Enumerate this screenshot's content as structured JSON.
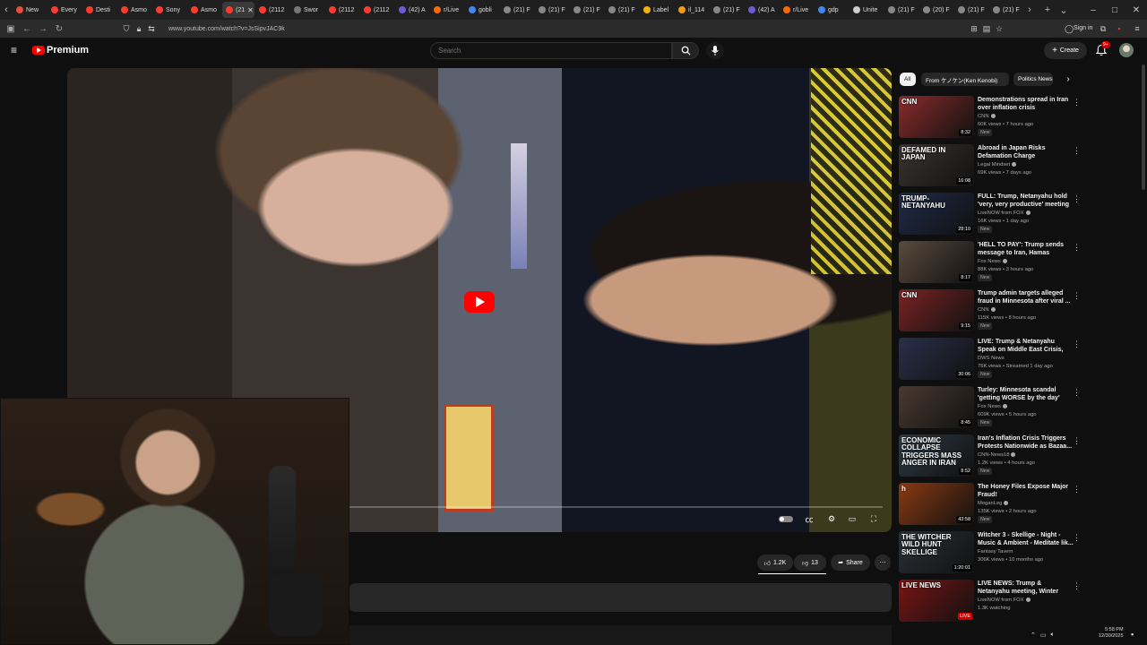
{
  "browser": {
    "tabs": [
      {
        "label": "New",
        "color": "#e74c3c"
      },
      {
        "label": "Every",
        "color": "#ff3b30"
      },
      {
        "label": "Desti",
        "color": "#ff3b30"
      },
      {
        "label": "Asmo",
        "color": "#ff3b30"
      },
      {
        "label": "Sony",
        "color": "#ff3b30"
      },
      {
        "label": "Asmo",
        "color": "#ff3b30"
      },
      {
        "label": "(21",
        "color": "#ff3b30",
        "active": true
      },
      {
        "label": "(2112",
        "color": "#ff3b30"
      },
      {
        "label": "Swor",
        "color": "#777777"
      },
      {
        "label": "(2112",
        "color": "#ff3b30"
      },
      {
        "label": "(2112",
        "color": "#ff3b30"
      },
      {
        "label": "(42) A",
        "color": "#6b5bd6"
      },
      {
        "label": "r/Live",
        "color": "#ff6a00"
      },
      {
        "label": "gobli",
        "color": "#4285f4"
      },
      {
        "label": "(21) F",
        "color": "#888888"
      },
      {
        "label": "(21) F",
        "color": "#888888"
      },
      {
        "label": "(21) F",
        "color": "#888888"
      },
      {
        "label": "(21) F",
        "color": "#888888"
      },
      {
        "label": "Label",
        "color": "#f4b400"
      },
      {
        "label": "il_114",
        "color": "#f39c12"
      },
      {
        "label": "(21) F",
        "color": "#888888"
      },
      {
        "label": "(42) A",
        "color": "#6b5bd6"
      },
      {
        "label": "r/Live",
        "color": "#ff6a00"
      },
      {
        "label": "gdp",
        "color": "#4285f4"
      },
      {
        "label": "Unite",
        "color": "#cccccc"
      },
      {
        "label": "(21) F",
        "color": "#888888"
      },
      {
        "label": "(20) F",
        "color": "#888888"
      },
      {
        "label": "(21) F",
        "color": "#888888"
      },
      {
        "label": "(21) F",
        "color": "#888888"
      }
    ],
    "url": "www.youtube.com/watch?v=JsSipvJAC9k",
    "sign_in": "Sign in"
  },
  "header": {
    "logo_text": "Premium",
    "search_placeholder": "Search",
    "create_label": "Create",
    "notif_count": "9+"
  },
  "player": {
    "controls": [
      "autoplay",
      "subtitles",
      "settings",
      "miniplayer",
      "fullscreen"
    ]
  },
  "actions": {
    "likes": "1.2K",
    "dislikes": "13",
    "share": "Share"
  },
  "chips": [
    {
      "label": "All",
      "active": true
    },
    {
      "label": "From ケノケン(Ken Kenobi)",
      "active": false
    },
    {
      "label": "Politics News",
      "active": false
    }
  ],
  "recommendations": [
    {
      "title": "Demonstrations spread in Iran over inflation crisis",
      "channel": "CNN",
      "verified": true,
      "meta": "60K views • 7 hours ago",
      "new": "New",
      "duration": "8:32",
      "thumb_text": "CNN",
      "thumb_bg": "#8a2b2b"
    },
    {
      "title": "Abroad in Japan Risks Defamation Charge",
      "channel": "Legal Mindset",
      "verified": true,
      "meta": "69K views • 7 days ago",
      "new": "",
      "duration": "16:08",
      "thumb_text": "DEFAMED IN JAPAN",
      "thumb_bg": "#3a3431"
    },
    {
      "title": "FULL: Trump, Netanyahu hold 'very, very productive' meeting ...",
      "channel": "LiveNOW from FOX",
      "verified": true,
      "meta": "16K views • 1 day ago",
      "new": "New",
      "duration": "28:10",
      "thumb_text": "TRUMP-NETANYAHU",
      "thumb_bg": "#1e2a48"
    },
    {
      "title": "'HELL TO PAY': Trump sends message to Iran, Hamas",
      "channel": "Fox News",
      "verified": true,
      "meta": "88K views • 3 hours ago",
      "new": "New",
      "duration": "8:17",
      "thumb_text": "",
      "thumb_bg": "#5a4a3d"
    },
    {
      "title": "Trump admin targets alleged fraud in Minnesota after viral ...",
      "channel": "CNN",
      "verified": true,
      "meta": "115K views • 8 hours ago",
      "new": "New",
      "duration": "9:15",
      "thumb_text": "CNN",
      "thumb_bg": "#7a2222"
    },
    {
      "title": "LIVE: Trump & Netanyahu Speak on Middle East Crisis, Hamas, ...",
      "channel": "DWS News",
      "verified": false,
      "meta": "76K views • Streamed 1 day ago",
      "new": "New",
      "duration": "30:06",
      "thumb_text": "",
      "thumb_bg": "#2a2f4a"
    },
    {
      "title": "Turley: Minnesota scandal 'getting WORSE by the day'",
      "channel": "Fox News",
      "verified": true,
      "meta": "609K views • 5 hours ago",
      "new": "New",
      "duration": "8:45",
      "thumb_text": "",
      "thumb_bg": "#4a3a30"
    },
    {
      "title": "Iran's Inflation Crisis Triggers Protests Nationwide as Bazaa...",
      "channel": "CNN-News18",
      "verified": true,
      "meta": "1.2K views • 4 hours ago",
      "new": "New",
      "duration": "8:52",
      "thumb_text": "ECONOMIC COLLAPSE TRIGGERS MASS ANGER IN IRAN",
      "thumb_bg": "#2d3a45"
    },
    {
      "title": "The Honey Files Expose Major Fraud!",
      "channel": "MeganLeg",
      "verified": true,
      "meta": "135K views • 2 hours ago",
      "new": "New",
      "duration": "43:58",
      "thumb_text": "h",
      "thumb_bg": "#8a3a12"
    },
    {
      "title": "Witcher 3 - Skellige - Night - Music & Ambient - Meditate lik...",
      "channel": "Fantasy Tavern",
      "verified": false,
      "meta": "306K views • 10 months ago",
      "new": "",
      "duration": "1:20:01",
      "thumb_text": "THE WITCHER WILD HUNT SKELLIGE",
      "thumb_bg": "#2b3136"
    },
    {
      "title": "LIVE NEWS: Trump & Netanyahu meeting, Winter weather, NYE ...",
      "channel": "LiveNOW from FOX",
      "verified": true,
      "meta": "1.3K watching",
      "new": "",
      "duration": "LIVE",
      "thumb_text": "LIVE NEWS",
      "thumb_bg": "#7a1414"
    }
  ],
  "tray": {
    "time": "5:58 PM",
    "date": "12/30/2025"
  }
}
